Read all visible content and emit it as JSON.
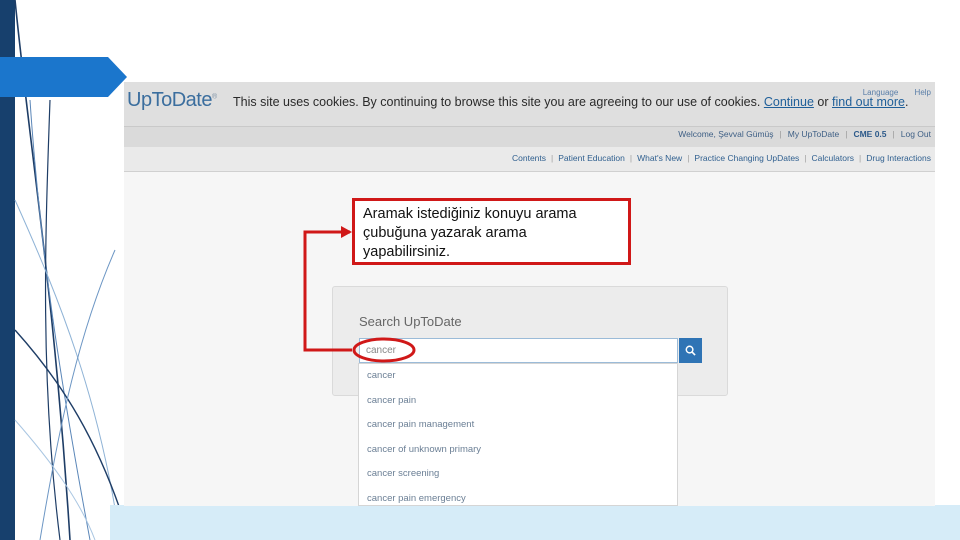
{
  "cookie_bar": {
    "logo": "UpToDate",
    "logo_mark": "®",
    "message": "This site uses cookies. By continuing to browse this site you are agreeing to our use of cookies.",
    "continue_link": "Continue",
    "connector": "or",
    "find_out_link": "find out more",
    "period": ".",
    "language_link": "Language",
    "help_link": "Help"
  },
  "user_bar": {
    "welcome": "Welcome, Şevval Gümüş",
    "my_uptodate": "My UpToDate",
    "cme": "CME 0.5",
    "logout": "Log Out"
  },
  "nav": {
    "items": [
      "Contents",
      "Patient Education",
      "What's New",
      "Practice Changing UpDates",
      "Calculators",
      "Drug Interactions"
    ]
  },
  "search": {
    "title": "Search UpToDate",
    "value": "cancer",
    "icon": "search-icon",
    "suggestions": [
      "cancer",
      "cancer pain",
      "cancer pain management",
      "cancer of unknown primary",
      "cancer screening",
      "cancer pain emergency"
    ]
  },
  "annotation": {
    "line1": "Aramak istediğiniz konuyu arama",
    "line2": "çubuğuna yazarak arama",
    "line3": "yapabilirsiniz.",
    "color": "#d01818"
  },
  "colors": {
    "slide_band": "#17406d",
    "arrow_tab": "#1b76cc",
    "accent_blue": "#2f74b5"
  }
}
